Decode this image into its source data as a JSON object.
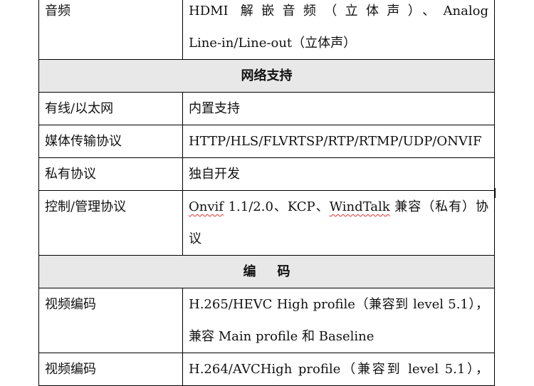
{
  "table": {
    "rows": [
      {
        "type": "row",
        "label": "音频",
        "lines": [
          "HDMI 解嵌音频（立体声）、Analog",
          "Line-in/Line-out（立体声）"
        ]
      },
      {
        "type": "section",
        "title": "网络支持"
      },
      {
        "type": "row",
        "label": "有线/以太网",
        "lines": [
          "内置支持"
        ]
      },
      {
        "type": "row",
        "label": "媒体传输协议",
        "lines": [
          "HTTP/HLS/FLVRTSP/RTP/RTMP/UDP/ONVIF"
        ]
      },
      {
        "type": "row",
        "label": "私有协议",
        "lines": [
          "独自开发"
        ]
      },
      {
        "type": "row",
        "label": "控制/管理协议",
        "segments": [
          "Onvif",
          " 1.1/2.0、KCP、",
          "WindTalk",
          " 兼容（私有）协"
        ],
        "line2": "议"
      },
      {
        "type": "section",
        "title": "编码"
      },
      {
        "type": "row",
        "label": "视频编码",
        "lines": [
          "H.265/HEVC High profile（兼容到 level 5.1），",
          "兼容 Main profile 和 Baseline"
        ]
      },
      {
        "type": "row",
        "label": "视频编码",
        "lines": [
          "H.264/AVCHigh profile（兼容到 level 5.1），"
        ]
      }
    ]
  }
}
